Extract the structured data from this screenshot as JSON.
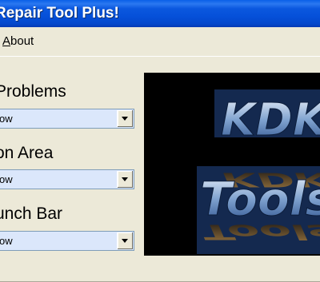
{
  "window": {
    "title": "Repair Tool Plus!"
  },
  "menu": {
    "about": {
      "accel": "A",
      "rest": "bout"
    }
  },
  "groups": [
    {
      "label": "Problems",
      "value": "ow"
    },
    {
      "label": "on Area",
      "value": "ow"
    },
    {
      "label": "unch Bar",
      "value": "ow"
    }
  ],
  "logo": {
    "line1": "KDK",
    "line2": "Tools"
  },
  "icons": {
    "dropdown": "chevron-down-icon"
  },
  "colors": {
    "titlebar": "#0550d9",
    "combo_bg": "#dbe7fb",
    "logo_bg": "#000000"
  }
}
